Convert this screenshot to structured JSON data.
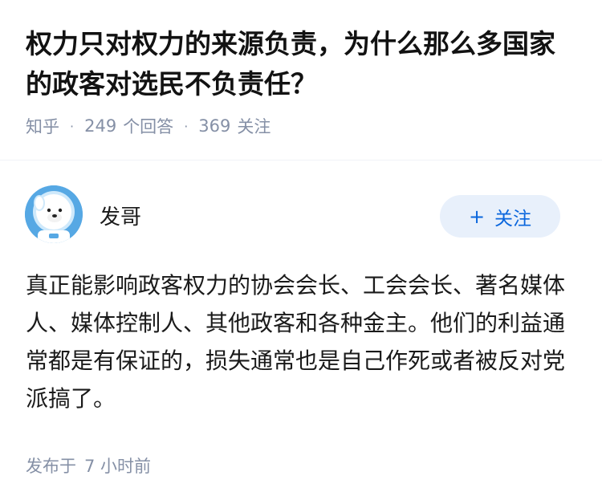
{
  "question": {
    "title": "权力只对权力的来源负责，为什么那么多国家的政客对选民不负责任？",
    "source": "知乎",
    "answers_count": "249",
    "answers_label": "个回答",
    "followers_count": "369",
    "followers_label": "关注"
  },
  "answer": {
    "author": {
      "name": "发哥",
      "avatar_icon": "bear-astronaut-avatar"
    },
    "follow_button": {
      "icon": "plus-icon",
      "label": "关注"
    },
    "content": "真正能影响政客权力的协会会长、工会会长、著名媒体人、媒体控制人、其他政客和各种金主。他们的利益通常都是有保证的，损失通常也是自己作死或者被反对党派搞了。",
    "published_label": "发布于",
    "published_time": "7 小时前"
  },
  "colors": {
    "title": "#121212",
    "meta": "#8590a6",
    "follow_bg": "#e8f0fb",
    "follow_text": "#0a66dd",
    "avatar_bg": "#56a8e4"
  }
}
